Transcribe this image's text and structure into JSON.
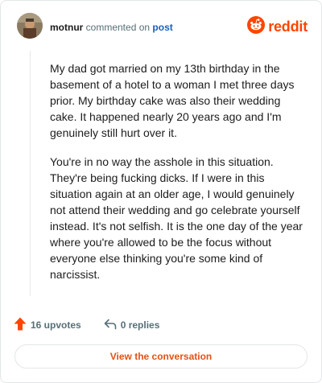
{
  "author": {
    "username": "motnur",
    "action_text": "commented on",
    "target_link": "post"
  },
  "brand": {
    "name": "reddit",
    "icon": "reddit-logo-icon",
    "color": "#ff4500"
  },
  "comment": {
    "paragraphs": [
      "My dad got married on my 13th birthday in the basement of a hotel to a woman I met three days prior. My birthday cake was also their wedding cake. It happened nearly 20 years ago and I'm genuinely still hurt over it.",
      "You're in no way the asshole in this situation. They're being fucking dicks. If I were in this situation again at an older age, I would genuinely not attend their wedding and go celebrate yourself instead. It's not selfish. It is the one day of the year where you're allowed to be the focus without everyone else thinking you're some kind of narcissist."
    ]
  },
  "actions": {
    "upvotes_label": "16 upvotes",
    "upvote_icon": "upvote-arrow-icon",
    "upvote_color": "#ff4500",
    "replies_label": "0 replies",
    "reply_icon": "reply-arrow-icon"
  },
  "cta": {
    "label": "View the conversation",
    "color": "#e45014"
  }
}
